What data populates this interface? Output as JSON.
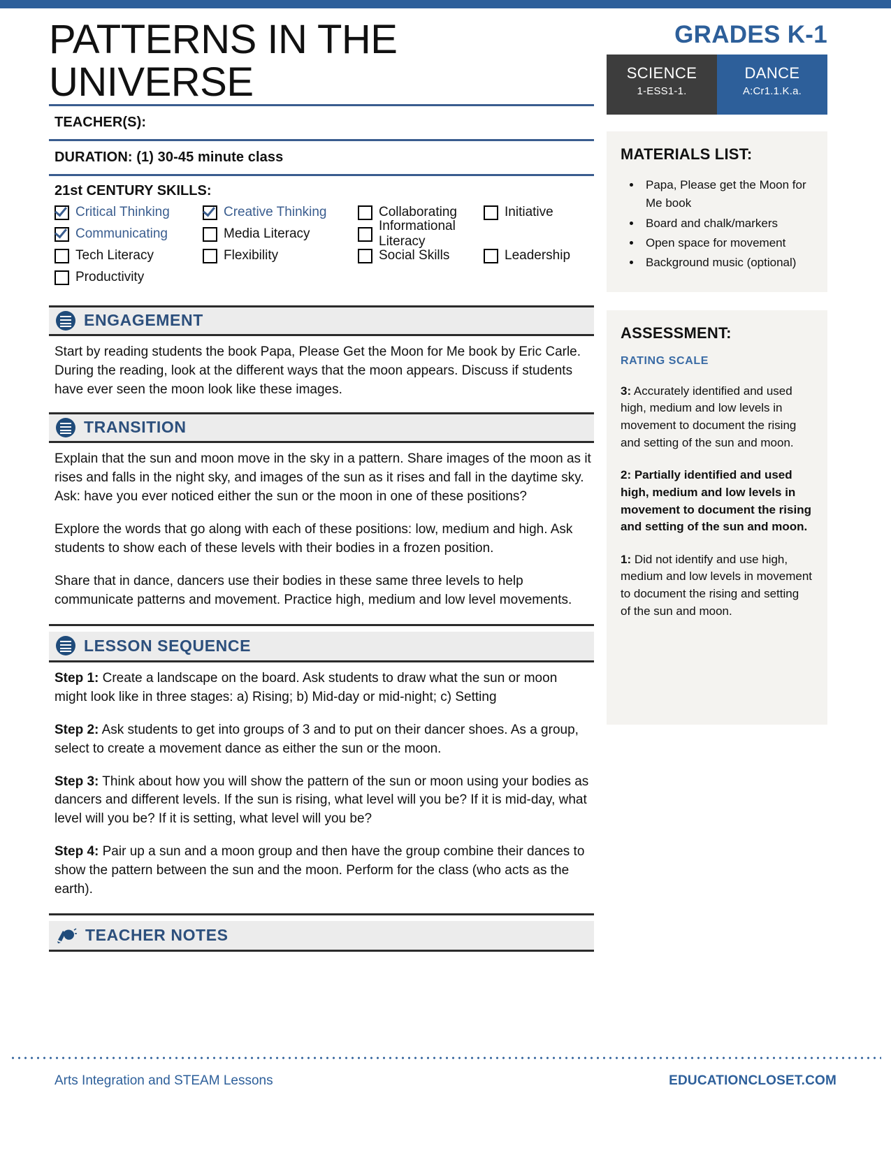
{
  "header": {
    "title": "PATTERNS IN THE UNIVERSE",
    "grades_label": "GRADES K-1",
    "standards": [
      {
        "subject": "SCIENCE",
        "code": "1-ESS1-1."
      },
      {
        "subject": "DANCE",
        "code": "A:Cr1.1.K.a."
      }
    ]
  },
  "fields": {
    "teachers_label": "TEACHER(S):",
    "duration_label": "DURATION: (1) 30-45 minute class"
  },
  "skills": {
    "title": "21st CENTURY SKILLS:",
    "items": [
      {
        "label": "Critical Thinking",
        "checked": true
      },
      {
        "label": "Creative Thinking",
        "checked": true
      },
      {
        "label": "Collaborating",
        "checked": false
      },
      {
        "label": "Initiative",
        "checked": false
      },
      {
        "label": "Communicating",
        "checked": true
      },
      {
        "label": "Media Literacy",
        "checked": false
      },
      {
        "label": "Informational Literacy",
        "checked": false
      },
      {
        "label": "Tech Literacy",
        "checked": false
      },
      {
        "label": "Flexibility",
        "checked": false
      },
      {
        "label": "Social Skills",
        "checked": false
      },
      {
        "label": "Leadership",
        "checked": false
      },
      {
        "label": "Productivity",
        "checked": false
      }
    ]
  },
  "sections": {
    "engagement": {
      "title": "ENGAGEMENT",
      "icon": "list-icon",
      "paragraphs": [
        "Start by reading students the book Papa, Please Get the Moon for Me book by Eric Carle. During the reading, look at the different ways that the moon appears. Discuss if students have ever seen the moon look like these images."
      ]
    },
    "transition": {
      "title": "TRANSITION",
      "icon": "list-icon",
      "paragraphs": [
        "Explain that the sun and moon move in the sky in a pattern. Share images of the moon as it rises and falls in the night sky, and images of the sun as it rises and fall in the daytime sky. Ask: have you ever noticed either the sun or the moon in one of these positions?",
        "Explore the words that go along with each of these positions: low, medium and high. Ask students to show each of these levels with their bodies in a frozen position.",
        "Share that in dance, dancers use their bodies in these same three levels to help communicate patterns and movement. Practice high, medium and low level movements."
      ]
    },
    "lesson_sequence": {
      "title": "LESSON SEQUENCE",
      "icon": "list-icon",
      "steps": [
        {
          "label": "Step 1:",
          "text": " Create a landscape on the board. Ask students to draw what the sun or moon might look like in three stages: a) Rising; b) Mid-day or mid-night; c) Setting"
        },
        {
          "label": "Step 2:",
          "text": " Ask students to get into groups of 3 and to put on their dancer shoes. As a group, select to create a movement dance as either the sun or the moon."
        },
        {
          "label": "Step 3:",
          "text": " Think about how you will show the pattern of the sun or moon using your bodies as dancers and different levels. If the sun is rising, what level will you be? If it is mid-day, what level will you be? If it is setting, what level will you be?"
        },
        {
          "label": "Step 4:",
          "text": " Pair up a sun and a moon group and then have the group combine their dances to show the pattern between the sun and the moon. Perform for the class (who acts as the earth)."
        }
      ]
    },
    "teacher_notes": {
      "title": "TEACHER NOTES",
      "icon": "hand-writing-icon",
      "body": ""
    }
  },
  "sidebar": {
    "materials": {
      "title": "MATERIALS LIST:",
      "items": [
        "Papa, Please get the Moon for Me book",
        "Board and chalk/markers",
        "Open space for movement",
        "Background music (optional)"
      ]
    },
    "assessment": {
      "title": "ASSESSMENT:",
      "rating_scale_label": "RATING SCALE",
      "levels": [
        {
          "num": "3:",
          "text": " Accurately identified and used high, medium and low levels in movement to document the rising and setting of the sun and moon."
        },
        {
          "num": "2:",
          "text": " Partially identified and used high, medium and low levels in movement to document the rising and setting of the sun and moon."
        },
        {
          "num": "1:",
          "text": " Did not identify and use high, medium and low levels in movement to document the rising and setting of the sun and moon."
        }
      ]
    }
  },
  "footer": {
    "left": "Arts Integration and STEAM Lessons",
    "right": "EDUCATIONCLOSET.COM"
  },
  "colors": {
    "brand_blue": "#2d5f9a",
    "rule_blue": "#3a5d8f",
    "science_box": "#3d3d3d",
    "dance_box": "#2d5f9a",
    "panel_bg": "#f4f3f0",
    "section_bg": "#ececec"
  }
}
